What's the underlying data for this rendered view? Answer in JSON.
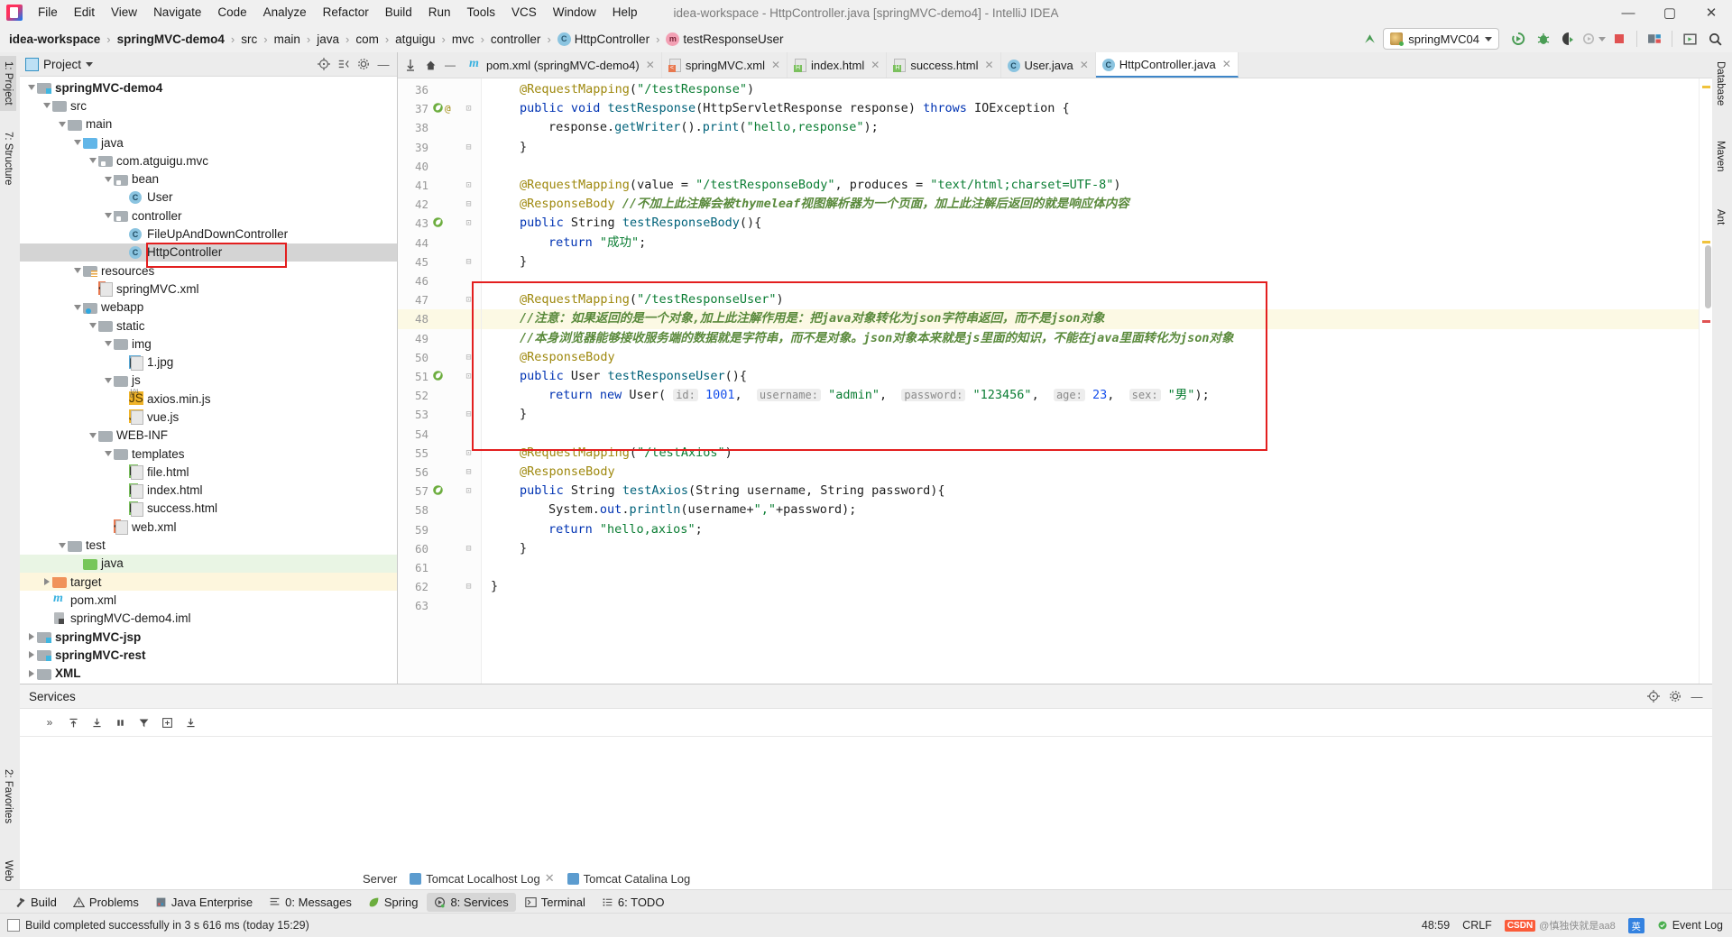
{
  "window": {
    "title": "idea-workspace - HttpController.java [springMVC-demo4] - IntelliJ IDEA",
    "minimize": "—",
    "maximize": "▢",
    "close": "✕"
  },
  "menubar": {
    "items": [
      "File",
      "Edit",
      "View",
      "Navigate",
      "Code",
      "Analyze",
      "Refactor",
      "Build",
      "Run",
      "Tools",
      "VCS",
      "Window",
      "Help"
    ]
  },
  "breadcrumb": {
    "items": [
      {
        "label": "idea-workspace",
        "bold": true,
        "icon": ""
      },
      {
        "label": "springMVC-demo4",
        "bold": true,
        "icon": ""
      },
      {
        "label": "src",
        "bold": false,
        "icon": ""
      },
      {
        "label": "main",
        "bold": false,
        "icon": ""
      },
      {
        "label": "java",
        "bold": false,
        "icon": ""
      },
      {
        "label": "com",
        "bold": false,
        "icon": ""
      },
      {
        "label": "atguigu",
        "bold": false,
        "icon": ""
      },
      {
        "label": "mvc",
        "bold": false,
        "icon": ""
      },
      {
        "label": "controller",
        "bold": false,
        "icon": ""
      },
      {
        "label": "HttpController",
        "bold": false,
        "icon": "class-icon"
      },
      {
        "label": "testResponseUser",
        "bold": false,
        "icon": "method-icon"
      }
    ],
    "separator": "›"
  },
  "toolbar": {
    "run_config": "springMVC04",
    "buttons": [
      "run-button",
      "debug-button",
      "run-coverage-button",
      "profile-button",
      "stop-button",
      "build-project-button",
      "preview-button",
      "search-everywhere-button"
    ],
    "update_label": "",
    "stop_color": "#e05252",
    "run_color": "#499c54"
  },
  "left_strip": {
    "tabs": [
      "1: Project",
      "7: Structure",
      "2: Favorites",
      "Web"
    ]
  },
  "right_strip": {
    "tabs": [
      "Database",
      "Maven",
      "Ant"
    ]
  },
  "project_panel": {
    "title": "Project",
    "tree": [
      {
        "depth": 1,
        "arrow": "down",
        "icon": "module",
        "label": "springMVC-demo4",
        "bold": true,
        "state": ""
      },
      {
        "depth": 2,
        "arrow": "down",
        "icon": "folder",
        "label": "src",
        "bold": false,
        "state": ""
      },
      {
        "depth": 3,
        "arrow": "down",
        "icon": "folder",
        "label": "main",
        "bold": false,
        "state": ""
      },
      {
        "depth": 4,
        "arrow": "down",
        "icon": "src",
        "label": "java",
        "bold": false,
        "state": ""
      },
      {
        "depth": 5,
        "arrow": "down",
        "icon": "pkg",
        "label": "com.atguigu.mvc",
        "bold": false,
        "state": ""
      },
      {
        "depth": 6,
        "arrow": "down",
        "icon": "pkg",
        "label": "bean",
        "bold": false,
        "state": ""
      },
      {
        "depth": 7,
        "arrow": "none",
        "icon": "class",
        "label": "User",
        "bold": false,
        "state": ""
      },
      {
        "depth": 6,
        "arrow": "down",
        "icon": "pkg",
        "label": "controller",
        "bold": false,
        "state": ""
      },
      {
        "depth": 7,
        "arrow": "none",
        "icon": "class",
        "label": "FileUpAndDownController",
        "bold": false,
        "state": ""
      },
      {
        "depth": 7,
        "arrow": "none",
        "icon": "class",
        "label": "HttpController",
        "bold": false,
        "state": "selected"
      },
      {
        "depth": 4,
        "arrow": "down",
        "icon": "res",
        "label": "resources",
        "bold": false,
        "state": ""
      },
      {
        "depth": 5,
        "arrow": "none",
        "icon": "xml",
        "label": "springMVC.xml",
        "bold": false,
        "state": ""
      },
      {
        "depth": 4,
        "arrow": "down",
        "icon": "web",
        "label": "webapp",
        "bold": false,
        "state": ""
      },
      {
        "depth": 5,
        "arrow": "down",
        "icon": "folder",
        "label": "static",
        "bold": false,
        "state": ""
      },
      {
        "depth": 6,
        "arrow": "down",
        "icon": "folder",
        "label": "img",
        "bold": false,
        "state": ""
      },
      {
        "depth": 7,
        "arrow": "none",
        "icon": "img",
        "label": "1.jpg",
        "bold": false,
        "state": ""
      },
      {
        "depth": 6,
        "arrow": "down",
        "icon": "folder",
        "label": "js",
        "bold": false,
        "state": ""
      },
      {
        "depth": 7,
        "arrow": "none",
        "icon": "jsmin",
        "label": "axios.min.js",
        "bold": false,
        "state": ""
      },
      {
        "depth": 7,
        "arrow": "none",
        "icon": "js",
        "label": "vue.js",
        "bold": false,
        "state": ""
      },
      {
        "depth": 5,
        "arrow": "down",
        "icon": "folder",
        "label": "WEB-INF",
        "bold": false,
        "state": ""
      },
      {
        "depth": 6,
        "arrow": "down",
        "icon": "folder",
        "label": "templates",
        "bold": false,
        "state": ""
      },
      {
        "depth": 7,
        "arrow": "none",
        "icon": "html",
        "label": "file.html",
        "bold": false,
        "state": ""
      },
      {
        "depth": 7,
        "arrow": "none",
        "icon": "html",
        "label": "index.html",
        "bold": false,
        "state": ""
      },
      {
        "depth": 7,
        "arrow": "none",
        "icon": "html",
        "label": "success.html",
        "bold": false,
        "state": ""
      },
      {
        "depth": 6,
        "arrow": "none",
        "icon": "xml",
        "label": "web.xml",
        "bold": false,
        "state": ""
      },
      {
        "depth": 3,
        "arrow": "down",
        "icon": "folder",
        "label": "test",
        "bold": false,
        "state": ""
      },
      {
        "depth": 4,
        "arrow": "none",
        "icon": "testsrc",
        "label": "java",
        "bold": false,
        "state": "green"
      },
      {
        "depth": 2,
        "arrow": "right",
        "icon": "target",
        "label": "target",
        "bold": false,
        "state": "yellow"
      },
      {
        "depth": 2,
        "arrow": "none",
        "icon": "maven",
        "label": "pom.xml",
        "bold": false,
        "state": ""
      },
      {
        "depth": 2,
        "arrow": "none",
        "icon": "iml",
        "label": "springMVC-demo4.iml",
        "bold": false,
        "state": ""
      },
      {
        "depth": 1,
        "arrow": "right",
        "icon": "module",
        "label": "springMVC-jsp",
        "bold": true,
        "state": ""
      },
      {
        "depth": 1,
        "arrow": "right",
        "icon": "module",
        "label": "springMVC-rest",
        "bold": true,
        "state": ""
      },
      {
        "depth": 1,
        "arrow": "right",
        "icon": "folder",
        "label": "XML",
        "bold": true,
        "state": ""
      }
    ]
  },
  "editor": {
    "tabs": [
      {
        "label": "pom.xml (springMVC-demo4)",
        "icon": "maven",
        "active": false
      },
      {
        "label": "springMVC.xml",
        "icon": "xml",
        "active": false
      },
      {
        "label": "index.html",
        "icon": "html",
        "active": false
      },
      {
        "label": "success.html",
        "icon": "html",
        "active": false
      },
      {
        "label": "User.java",
        "icon": "class",
        "active": false
      },
      {
        "label": "HttpController.java",
        "icon": "class",
        "active": true
      }
    ],
    "close_glyph": "✕",
    "first_line": 36,
    "lines": [
      {
        "n": 36,
        "indent": 1,
        "tokens": [
          {
            "t": "ann",
            "v": "@RequestMapping"
          },
          {
            "t": "pun",
            "v": "("
          },
          {
            "t": "str",
            "v": "\"/testResponse\""
          },
          {
            "t": "pun",
            "v": ")"
          }
        ]
      },
      {
        "n": 37,
        "indent": 1,
        "gutter": "run-bean",
        "tokens": [
          {
            "t": "kw",
            "v": "public "
          },
          {
            "t": "kw",
            "v": "void "
          },
          {
            "t": "mth",
            "v": "testResponse"
          },
          {
            "t": "pun",
            "v": "("
          },
          {
            "t": "typ",
            "v": "HttpServletResponse response"
          },
          {
            "t": "pun",
            "v": ") "
          },
          {
            "t": "kw",
            "v": "throws "
          },
          {
            "t": "typ",
            "v": "IOException {"
          }
        ]
      },
      {
        "n": 38,
        "indent": 2,
        "tokens": [
          {
            "t": "typ",
            "v": "response"
          },
          {
            "t": "pun",
            "v": "."
          },
          {
            "t": "mth",
            "v": "getWriter"
          },
          {
            "t": "pun",
            "v": "()."
          },
          {
            "t": "mth",
            "v": "print"
          },
          {
            "t": "pun",
            "v": "("
          },
          {
            "t": "str",
            "v": "\"hello,response\""
          },
          {
            "t": "pun",
            "v": ");"
          }
        ]
      },
      {
        "n": 39,
        "indent": 1,
        "tokens": [
          {
            "t": "pun",
            "v": "}"
          }
        ]
      },
      {
        "n": 40,
        "indent": 0,
        "tokens": []
      },
      {
        "n": 41,
        "indent": 1,
        "tokens": [
          {
            "t": "ann",
            "v": "@RequestMapping"
          },
          {
            "t": "pun",
            "v": "("
          },
          {
            "t": "typ",
            "v": "value = "
          },
          {
            "t": "str",
            "v": "\"/testResponseBody\""
          },
          {
            "t": "pun",
            "v": ", "
          },
          {
            "t": "typ",
            "v": "produces = "
          },
          {
            "t": "str",
            "v": "\"text/html;charset=UTF-8\""
          },
          {
            "t": "pun",
            "v": ")"
          }
        ]
      },
      {
        "n": 42,
        "indent": 1,
        "tokens": [
          {
            "t": "ann",
            "v": "@ResponseBody "
          },
          {
            "t": "cmt",
            "v": "//不加上此注解会被thymeleaf视图解析器为一个页面，加上此注解后返回的就是响应体内容"
          }
        ]
      },
      {
        "n": 43,
        "indent": 1,
        "gutter": "bean",
        "tokens": [
          {
            "t": "kw",
            "v": "public "
          },
          {
            "t": "typ",
            "v": "String "
          },
          {
            "t": "mth",
            "v": "testResponseBody"
          },
          {
            "t": "pun",
            "v": "(){"
          }
        ]
      },
      {
        "n": 44,
        "indent": 2,
        "tokens": [
          {
            "t": "kw",
            "v": "return "
          },
          {
            "t": "str",
            "v": "\"成功\""
          },
          {
            "t": "pun",
            "v": ";"
          }
        ]
      },
      {
        "n": 45,
        "indent": 1,
        "tokens": [
          {
            "t": "pun",
            "v": "}"
          }
        ]
      },
      {
        "n": 46,
        "indent": 0,
        "tokens": []
      },
      {
        "n": 47,
        "indent": 1,
        "tokens": [
          {
            "t": "ann",
            "v": "@RequestMapping"
          },
          {
            "t": "pun",
            "v": "("
          },
          {
            "t": "str",
            "v": "\"/testResponseUser\""
          },
          {
            "t": "pun",
            "v": ")"
          }
        ]
      },
      {
        "n": 48,
        "indent": 1,
        "highlight": true,
        "bulb": true,
        "tokens": [
          {
            "t": "cmt",
            "v": "//注意：如果返回的是一个对象,加上此注解作用是：把java对象转化为json字符串返回，而不是json对象"
          }
        ]
      },
      {
        "n": 49,
        "indent": 1,
        "tokens": [
          {
            "t": "cmt",
            "v": "//本身浏览器能够接收服务端的数据就是字符串，而不是对象。json对象本来就是js里面的知识，不能在java里面转化为json对象"
          }
        ]
      },
      {
        "n": 50,
        "indent": 1,
        "tokens": [
          {
            "t": "ann",
            "v": "@ResponseBody"
          }
        ]
      },
      {
        "n": 51,
        "indent": 1,
        "gutter": "bean",
        "tokens": [
          {
            "t": "kw",
            "v": "public "
          },
          {
            "t": "typ",
            "v": "User "
          },
          {
            "t": "mth",
            "v": "testResponseUser"
          },
          {
            "t": "pun",
            "v": "(){"
          }
        ]
      },
      {
        "n": 52,
        "indent": 2,
        "tokens": [
          {
            "t": "kw",
            "v": "return "
          },
          {
            "t": "kw",
            "v": "new "
          },
          {
            "t": "typ",
            "v": "User"
          },
          {
            "t": "pun",
            "v": "( "
          },
          {
            "t": "hint",
            "v": "id:"
          },
          {
            "t": "num",
            "v": " 1001"
          },
          {
            "t": "pun",
            "v": ",  "
          },
          {
            "t": "hint",
            "v": "username:"
          },
          {
            "t": "str",
            "v": " \"admin\""
          },
          {
            "t": "pun",
            "v": ",  "
          },
          {
            "t": "hint",
            "v": "password:"
          },
          {
            "t": "str",
            "v": " \"123456\""
          },
          {
            "t": "pun",
            "v": ",  "
          },
          {
            "t": "hint",
            "v": "age:"
          },
          {
            "t": "num",
            "v": " 23"
          },
          {
            "t": "pun",
            "v": ",  "
          },
          {
            "t": "hint",
            "v": "sex:"
          },
          {
            "t": "str",
            "v": " \"男\""
          },
          {
            "t": "pun",
            "v": ");"
          }
        ]
      },
      {
        "n": 53,
        "indent": 1,
        "tokens": [
          {
            "t": "pun",
            "v": "}"
          }
        ]
      },
      {
        "n": 54,
        "indent": 0,
        "tokens": []
      },
      {
        "n": 55,
        "indent": 1,
        "tokens": [
          {
            "t": "ann",
            "v": "@RequestMapping"
          },
          {
            "t": "pun",
            "v": "("
          },
          {
            "t": "str",
            "v": "\"/testAxios\""
          },
          {
            "t": "pun",
            "v": ")"
          }
        ]
      },
      {
        "n": 56,
        "indent": 1,
        "tokens": [
          {
            "t": "ann",
            "v": "@ResponseBody"
          }
        ]
      },
      {
        "n": 57,
        "indent": 1,
        "gutter": "bean",
        "tokens": [
          {
            "t": "kw",
            "v": "public "
          },
          {
            "t": "typ",
            "v": "String "
          },
          {
            "t": "mth",
            "v": "testAxios"
          },
          {
            "t": "pun",
            "v": "("
          },
          {
            "t": "typ",
            "v": "String username, String password"
          },
          {
            "t": "pun",
            "v": "){"
          }
        ]
      },
      {
        "n": 58,
        "indent": 2,
        "tokens": [
          {
            "t": "typ",
            "v": "System"
          },
          {
            "t": "pun",
            "v": "."
          },
          {
            "t": "kw",
            "v": "out"
          },
          {
            "t": "pun",
            "v": "."
          },
          {
            "t": "mth",
            "v": "println"
          },
          {
            "t": "pun",
            "v": "(username+"
          },
          {
            "t": "str",
            "v": "\",\""
          },
          {
            "t": "pun",
            "v": "+password);"
          }
        ]
      },
      {
        "n": 59,
        "indent": 2,
        "tokens": [
          {
            "t": "kw",
            "v": "return "
          },
          {
            "t": "str",
            "v": "\"hello,axios\""
          },
          {
            "t": "pun",
            "v": ";"
          }
        ]
      },
      {
        "n": 60,
        "indent": 1,
        "tokens": [
          {
            "t": "pun",
            "v": "}"
          }
        ]
      },
      {
        "n": 61,
        "indent": 0,
        "tokens": []
      },
      {
        "n": 62,
        "indent": 0,
        "tokens": [
          {
            "t": "pun",
            "v": "}"
          }
        ]
      },
      {
        "n": 63,
        "indent": 0,
        "tokens": []
      }
    ]
  },
  "services": {
    "title": "Services",
    "tabs": [
      {
        "label": "Server",
        "icon": ""
      },
      {
        "label": "Tomcat Localhost Log",
        "icon": "tomcat"
      },
      {
        "label": "Tomcat Catalina Log",
        "icon": "tomcat"
      }
    ],
    "close_glyph": "✕",
    "expand_glyph": "»"
  },
  "toolwindow_bar": {
    "items": [
      {
        "label": "Build",
        "icon": "hammer-icon",
        "active": false
      },
      {
        "label": "Problems",
        "icon": "warning-icon",
        "active": false
      },
      {
        "label": "Java Enterprise",
        "icon": "javaee-icon",
        "active": false
      },
      {
        "label": "0: Messages",
        "icon": "messages-icon",
        "active": false
      },
      {
        "label": "Spring",
        "icon": "spring-leaf-icon",
        "active": false
      },
      {
        "label": "8: Services",
        "icon": "services-icon",
        "active": true
      },
      {
        "label": "Terminal",
        "icon": "terminal-icon",
        "active": false
      },
      {
        "label": "6: TODO",
        "icon": "todo-icon",
        "active": false
      }
    ]
  },
  "statusbar": {
    "message": "Build completed successfully in 3 s 616 ms (today 15:29)",
    "caret": "48:59",
    "line_sep": "CRLF",
    "event_log": "Event Log",
    "watermark_csdn": "CSDN",
    "watermark_ime": "英",
    "watermark_user": "@慎独侠就是aa8"
  }
}
